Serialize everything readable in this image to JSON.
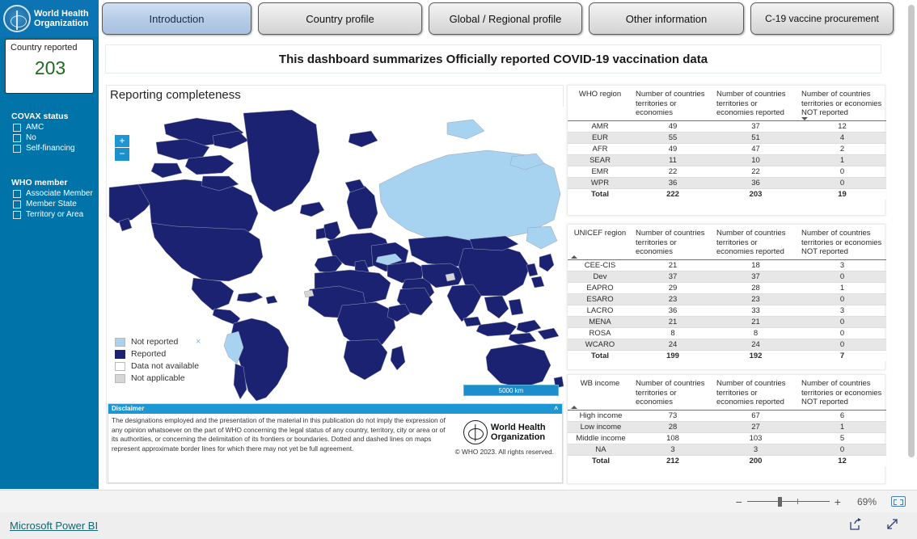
{
  "brand": {
    "logo_line1": "World Health",
    "logo_line2": "Organization",
    "logo_icon": "who-emblem-icon"
  },
  "tabs": [
    {
      "label": "Introduction",
      "active": true
    },
    {
      "label": "Country profile",
      "active": false
    },
    {
      "label": "Global / Regional profile",
      "active": false
    },
    {
      "label": "Other information",
      "active": false
    },
    {
      "label": "C-19 vaccine procurement",
      "active": false
    }
  ],
  "banner": {
    "text": "This dashboard summarizes Officially reported COVID-19 vaccination data"
  },
  "sidebar": {
    "kpi": {
      "label": "Country reported",
      "value": "203",
      "value_color": "#1f6b1f"
    },
    "filters": [
      {
        "title": "COVAX status",
        "items": [
          {
            "label": "AMC",
            "checked": false
          },
          {
            "label": "No",
            "checked": false
          },
          {
            "label": "Self-financing",
            "checked": false
          }
        ]
      },
      {
        "title": "WHO member",
        "items": [
          {
            "label": "Associate Member",
            "checked": false
          },
          {
            "label": "Member State",
            "checked": false
          },
          {
            "label": "Territory or Area",
            "checked": false
          }
        ]
      }
    ]
  },
  "map": {
    "title": "Reporting completeness",
    "zoom_in_label": "+",
    "zoom_out_label": "−",
    "scalebar_label": "5000 km",
    "legend_close_label": "×",
    "legend": [
      {
        "label": "Not reported",
        "color": "#a8d3f0"
      },
      {
        "label": "Reported",
        "color": "#1b2272"
      },
      {
        "label": "Data not available",
        "color": "#ffffff"
      },
      {
        "label": "Not applicable",
        "color": "#d6d6d6"
      }
    ],
    "colors": {
      "reported": "#1b2272",
      "not_reported": "#a8d3f0",
      "not_available": "#ffffff",
      "not_applicable": "#d6d6d6",
      "border": "#9aa0b5"
    }
  },
  "disclaimer": {
    "header": "Disclaimer",
    "collapse_label": "˄",
    "text": "The designations employed and the presentation of the material in this publication do not imply the expression of any opinion whatsoever on the part of WHO concerning the legal status of any country, territory, city or area or of its authorities, or concerning the delimitation of its frontiers or boundaries. Dotted and dashed lines on maps represent approximate border lines for which there may not yet be full agreement.",
    "logo_line1": "World Health",
    "logo_line2": "Organization",
    "copyright": "© WHO 2023. All rights reserved."
  },
  "tables": [
    {
      "id": "who-region",
      "sort_column": 3,
      "sort_direction": "desc",
      "headers": [
        "WHO region",
        "Number of countries territories or economies",
        "Number of countries territories or economies reported",
        "Number of countries territories or economies NOT reported"
      ],
      "rows": [
        {
          "cells": [
            "AMR",
            "49",
            "37",
            "12"
          ]
        },
        {
          "cells": [
            "EUR",
            "55",
            "51",
            "4"
          ]
        },
        {
          "cells": [
            "AFR",
            "49",
            "47",
            "2"
          ]
        },
        {
          "cells": [
            "SEAR",
            "11",
            "10",
            "1"
          ]
        },
        {
          "cells": [
            "EMR",
            "22",
            "22",
            "0"
          ]
        },
        {
          "cells": [
            "WPR",
            "36",
            "36",
            "0"
          ]
        }
      ],
      "total": {
        "cells": [
          "Total",
          "222",
          "203",
          "19"
        ]
      }
    },
    {
      "id": "unicef-region",
      "sort_column": 0,
      "sort_direction": "asc",
      "headers": [
        "UNICEF region",
        "Number of countries territories or economies",
        "Number of countries territories or economies reported",
        "Number of countries territories or economies NOT reported"
      ],
      "rows": [
        {
          "cells": [
            "CEE-CIS",
            "21",
            "18",
            "3"
          ]
        },
        {
          "cells": [
            "Dev",
            "37",
            "37",
            "0"
          ]
        },
        {
          "cells": [
            "EAPRO",
            "29",
            "28",
            "1"
          ]
        },
        {
          "cells": [
            "ESARO",
            "23",
            "23",
            "0"
          ]
        },
        {
          "cells": [
            "LACRO",
            "36",
            "33",
            "3"
          ]
        },
        {
          "cells": [
            "MENA",
            "21",
            "21",
            "0"
          ]
        },
        {
          "cells": [
            "ROSA",
            "8",
            "8",
            "0"
          ]
        },
        {
          "cells": [
            "WCARO",
            "24",
            "24",
            "0"
          ]
        }
      ],
      "total": {
        "cells": [
          "Total",
          "199",
          "192",
          "7"
        ]
      }
    },
    {
      "id": "wb-income",
      "sort_column": 0,
      "sort_direction": "asc",
      "headers": [
        "WB income",
        "Number of countries territories or economies",
        "Number of countries territories or economies reported",
        "Number of countries territories or economies NOT reported"
      ],
      "rows": [
        {
          "cells": [
            "High income",
            "73",
            "67",
            "6"
          ]
        },
        {
          "cells": [
            "Low income",
            "28",
            "27",
            "1"
          ]
        },
        {
          "cells": [
            "Middle income",
            "108",
            "103",
            "5"
          ]
        },
        {
          "cells": [
            "NA",
            "3",
            "3",
            "0"
          ]
        }
      ],
      "total": {
        "cells": [
          "Total",
          "212",
          "200",
          "12"
        ]
      }
    }
  ],
  "statusbar": {
    "zoom_out": "−",
    "zoom_in": "+",
    "zoom_percent": "69%",
    "fit_icon": "fit-to-screen-icon"
  },
  "footer": {
    "powerbi_label": "Microsoft Power BI",
    "share_icon": "share-icon",
    "fullscreen_icon": "fullscreen-icon"
  }
}
